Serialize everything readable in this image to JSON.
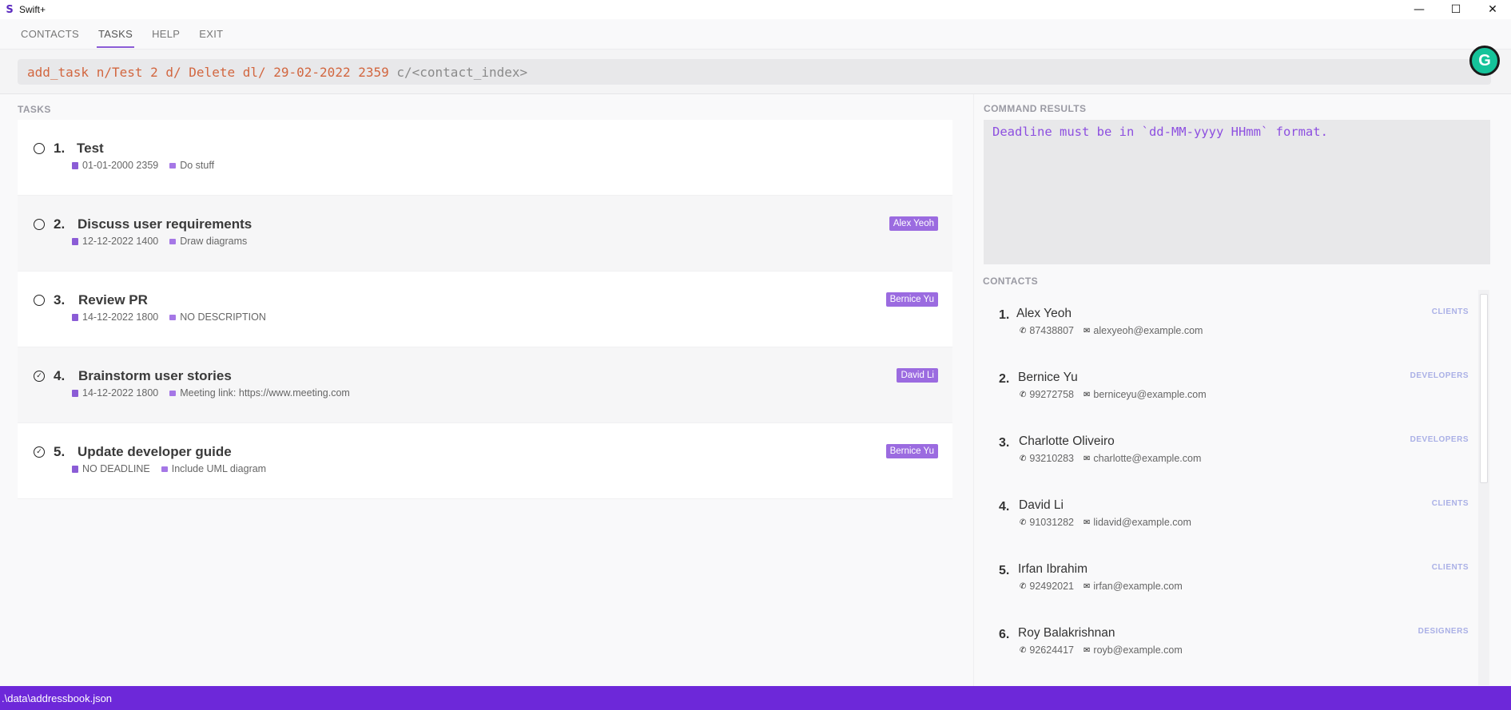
{
  "window": {
    "title": "Swift+",
    "logo": "S",
    "controls": {
      "minimize": "—",
      "maximize": "☐",
      "close": "✕"
    }
  },
  "menu": [
    {
      "label": "CONTACTS"
    },
    {
      "label": "TASKS"
    },
    {
      "label": "HELP"
    },
    {
      "label": "EXIT"
    }
  ],
  "command": {
    "typed": "add_task n/Test 2 d/ Delete dl/ 29-02-2022 2359 ",
    "hint": "c/<contact_index>"
  },
  "grammarly": {
    "icon": "grammarly-icon",
    "glyph": "G"
  },
  "tasks_label": "TASKS",
  "tasks": [
    {
      "index": "1.",
      "title": "Test",
      "deadline": "01-01-2000 2359",
      "description": "Do stuff",
      "tag": "",
      "done": false
    },
    {
      "index": "2.",
      "title": "Discuss user requirements",
      "deadline": "12-12-2022 1400",
      "description": "Draw diagrams",
      "tag": "Alex Yeoh",
      "done": false
    },
    {
      "index": "3.",
      "title": "Review PR",
      "deadline": "14-12-2022 1800",
      "description": "NO DESCRIPTION",
      "tag": "Bernice Yu",
      "done": false
    },
    {
      "index": "4.",
      "title": "Brainstorm user stories",
      "deadline": "14-12-2022 1800",
      "description": "Meeting link: https://www.meeting.com",
      "tag": "David Li",
      "done": true
    },
    {
      "index": "5.",
      "title": "Update developer guide",
      "deadline": "NO DEADLINE",
      "description": "Include UML diagram",
      "tag": "Bernice Yu",
      "done": true
    }
  ],
  "results_label": "COMMAND RESULTS",
  "result_message": "Deadline must be in `dd-MM-yyyy HHmm` format.",
  "contacts_label": "CONTACTS",
  "contacts": [
    {
      "index": "1.",
      "name": "Alex Yeoh",
      "phone": "87438807",
      "email": "alexyeoh@example.com",
      "group": "CLIENTS"
    },
    {
      "index": "2.",
      "name": "Bernice Yu",
      "phone": "99272758",
      "email": "berniceyu@example.com",
      "group": "DEVELOPERS"
    },
    {
      "index": "3.",
      "name": "Charlotte Oliveiro",
      "phone": "93210283",
      "email": "charlotte@example.com",
      "group": "DEVELOPERS"
    },
    {
      "index": "4.",
      "name": "David Li",
      "phone": "91031282",
      "email": "lidavid@example.com",
      "group": "CLIENTS"
    },
    {
      "index": "5.",
      "name": "Irfan Ibrahim",
      "phone": "92492021",
      "email": "irfan@example.com",
      "group": "CLIENTS"
    },
    {
      "index": "6.",
      "name": "Roy Balakrishnan",
      "phone": "92624417",
      "email": "royb@example.com",
      "group": "DESIGNERS"
    }
  ],
  "status_bar": ".\\data\\addressbook.json",
  "colors": {
    "accent": "#6d28d9",
    "tag": "#9b6be0",
    "error": "#8d4fe0",
    "command": "#d2663f"
  }
}
